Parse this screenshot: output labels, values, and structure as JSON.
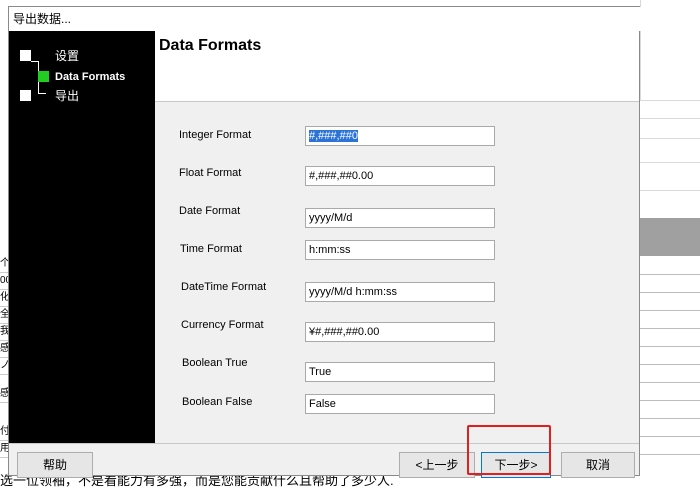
{
  "dialog": {
    "title": "导出数据...",
    "header_title": "Data Formats"
  },
  "steps": [
    {
      "label": "设置",
      "current": false
    },
    {
      "label": "Data Formats",
      "current": true
    },
    {
      "label": "导出",
      "current": false
    }
  ],
  "fields": [
    {
      "label": "Integer Format",
      "value": "#,###,##0",
      "selected": true
    },
    {
      "label": "Float Format",
      "value": "#,###,##0.00",
      "selected": false
    },
    {
      "label": "Date Format",
      "value": "yyyy/M/d",
      "selected": false
    },
    {
      "label": "Time Format",
      "value": "h:mm:ss",
      "selected": false
    },
    {
      "label": "DateTime Format",
      "value": "yyyy/M/d h:mm:ss",
      "selected": false
    },
    {
      "label": "Currency Format",
      "value": "¥#,###,##0.00",
      "selected": false
    },
    {
      "label": "Boolean True",
      "value": "True",
      "selected": false
    },
    {
      "label": "Boolean False",
      "value": "False",
      "selected": false
    }
  ],
  "buttons": {
    "help": "帮助",
    "back": "<上一步",
    "next": "下一步>",
    "cancel": "取消"
  },
  "background": {
    "left_cells": [
      "个",
      "00",
      "化",
      "全",
      "我",
      "感",
      "ノ",
      "",
      "感",
      "",
      "付",
      "用"
    ],
    "bottom_text": "选一位领袖，不是看能力有多强，而是您能贡献什么且帮助了多少人."
  },
  "colors": {
    "step_current": "#22cc22",
    "selection": "#2b73d6",
    "highlight": "#e02020"
  }
}
